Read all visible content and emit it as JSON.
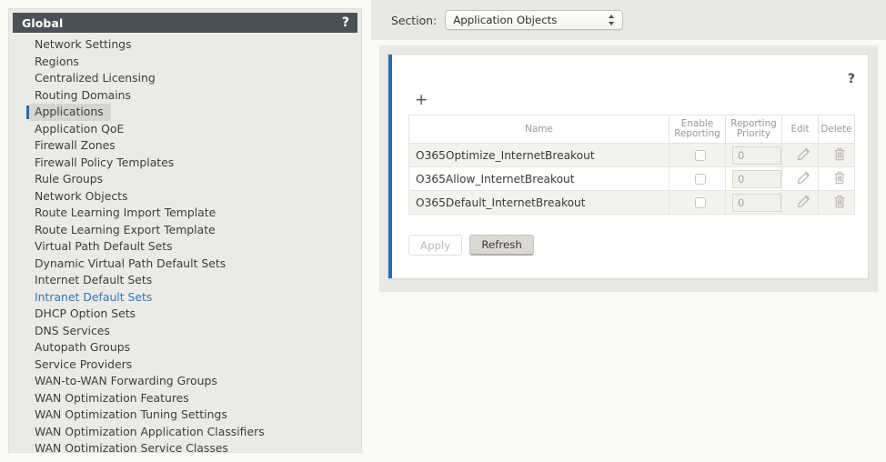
{
  "sidebar": {
    "header": {
      "title": "Global",
      "help_label": "?"
    },
    "items": [
      {
        "label": "Network Settings",
        "state": "normal"
      },
      {
        "label": "Regions",
        "state": "normal"
      },
      {
        "label": "Centralized Licensing",
        "state": "normal"
      },
      {
        "label": "Routing Domains",
        "state": "normal"
      },
      {
        "label": "Applications",
        "state": "selected"
      },
      {
        "label": "Application QoE",
        "state": "normal"
      },
      {
        "label": "Firewall Zones",
        "state": "normal"
      },
      {
        "label": "Firewall Policy Templates",
        "state": "normal"
      },
      {
        "label": "Rule Groups",
        "state": "normal"
      },
      {
        "label": "Network Objects",
        "state": "normal"
      },
      {
        "label": "Route Learning Import Template",
        "state": "normal"
      },
      {
        "label": "Route Learning Export Template",
        "state": "normal"
      },
      {
        "label": "Virtual Path Default Sets",
        "state": "normal"
      },
      {
        "label": "Dynamic Virtual Path Default Sets",
        "state": "normal"
      },
      {
        "label": "Internet Default Sets",
        "state": "normal"
      },
      {
        "label": "Intranet Default Sets",
        "state": "link"
      },
      {
        "label": "DHCP Option Sets",
        "state": "normal"
      },
      {
        "label": "DNS Services",
        "state": "normal"
      },
      {
        "label": "Autopath Groups",
        "state": "normal"
      },
      {
        "label": "Service Providers",
        "state": "normal"
      },
      {
        "label": "WAN-to-WAN Forwarding Groups",
        "state": "normal"
      },
      {
        "label": "WAN Optimization Features",
        "state": "normal"
      },
      {
        "label": "WAN Optimization Tuning Settings",
        "state": "normal"
      },
      {
        "label": "WAN Optimization Application Classifiers",
        "state": "normal"
      },
      {
        "label": "WAN Optimization Service Classes",
        "state": "normal"
      }
    ]
  },
  "main": {
    "section": {
      "label": "Section:",
      "selected": "Application Objects",
      "options": [
        "Application Objects"
      ]
    },
    "panel": {
      "help_label": "?",
      "add_label": "+",
      "accent_color": "#1f6fb4",
      "table": {
        "columns": [
          "Name",
          "Enable Reporting",
          "Reporting Priority",
          "Edit",
          "Delete"
        ],
        "column_lines": [
          [
            "Name"
          ],
          [
            "Enable",
            "Reporting"
          ],
          [
            "Reporting",
            "Priority"
          ],
          [
            "Edit"
          ],
          [
            "Delete"
          ]
        ],
        "rows": [
          {
            "name": "O365Optimize_InternetBreakout",
            "enable_reporting": false,
            "reporting_priority": "0"
          },
          {
            "name": "O365Allow_InternetBreakout",
            "enable_reporting": false,
            "reporting_priority": "0"
          },
          {
            "name": "O365Default_InternetBreakout",
            "enable_reporting": false,
            "reporting_priority": "0"
          }
        ]
      },
      "buttons": {
        "apply": {
          "label": "Apply",
          "disabled": true
        },
        "refresh": {
          "label": "Refresh",
          "disabled": false
        }
      }
    }
  },
  "icons": {
    "edit": "pencil-icon",
    "delete": "trash-icon",
    "add": "plus-icon",
    "help": "question-mark-icon",
    "select_arrows": "updown-chevron-icon"
  }
}
